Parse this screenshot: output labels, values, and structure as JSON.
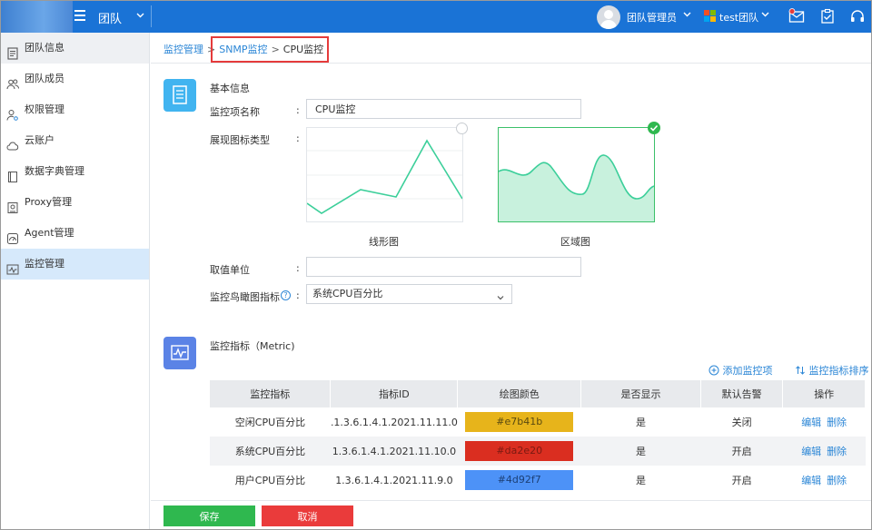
{
  "header": {
    "team_title": "团队",
    "role_label": "团队管理员",
    "org_label": "test团队",
    "colors": {
      "bar": "#1a73d6"
    }
  },
  "sidebar": {
    "items": [
      {
        "label": "团队信息",
        "icon": "document-icon"
      },
      {
        "label": "团队成员",
        "icon": "users-icon"
      },
      {
        "label": "权限管理",
        "icon": "user-key-icon"
      },
      {
        "label": "云账户",
        "icon": "cloud-icon"
      },
      {
        "label": "数据字典管理",
        "icon": "book-icon"
      },
      {
        "label": "Proxy管理",
        "icon": "proxy-icon"
      },
      {
        "label": "Agent管理",
        "icon": "agent-icon"
      },
      {
        "label": "监控管理",
        "icon": "monitor-icon"
      }
    ],
    "active_index": 7
  },
  "breadcrumb": {
    "root": "监控管理",
    "middle": "SNMP监控",
    "current": "CPU监控",
    "separator": ">"
  },
  "basic_info": {
    "section_title": "基本信息",
    "name_label": "监控项名称",
    "name_value": "CPU监控",
    "chart_type_label": "展现图标类型",
    "chart_options": [
      {
        "caption": "线形图",
        "selected": false
      },
      {
        "caption": "区域图",
        "selected": true
      }
    ],
    "unit_label": "取值单位",
    "unit_value": "",
    "thumbnail_label": "监控鸟瞰图指标",
    "thumbnail_value": "系统CPU百分比",
    "colon": ":"
  },
  "metrics": {
    "section_title": "监控指标（Metric)",
    "add_label": "添加监控项",
    "sort_label": "监控指标排序",
    "columns": [
      "监控指标",
      "指标ID",
      "绘图颜色",
      "是否显示",
      "默认告警",
      "操作"
    ],
    "rows": [
      {
        "name": "空闲CPU百分比",
        "id": ".1.3.6.1.4.1.2021.11.11.0",
        "color": "#e7b41b",
        "color_label": "#e7b41b",
        "visible": "是",
        "alarm": "关闭"
      },
      {
        "name": "系统CPU百分比",
        "id": "1.3.6.1.4.1.2021.11.10.0",
        "color": "#da2e20",
        "color_label": "#da2e20",
        "visible": "是",
        "alarm": "开启"
      },
      {
        "name": "用户CPU百分比",
        "id": "1.3.6.1.4.1.2021.11.9.0",
        "color": "#4d92f7",
        "color_label": "#4d92f7",
        "visible": "是",
        "alarm": "开启"
      }
    ],
    "edit_label": "编辑",
    "delete_label": "删除"
  },
  "footer": {
    "save_label": "保存",
    "cancel_label": "取消"
  }
}
